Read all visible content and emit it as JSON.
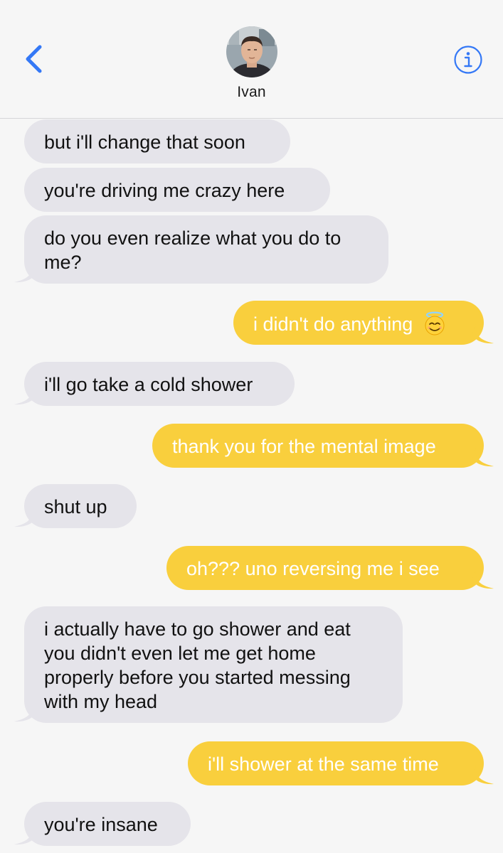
{
  "header": {
    "contact_name": "Ivan",
    "back_icon": "chevron-left-icon",
    "info_icon": "info-icon",
    "accent_color": "#3478f6"
  },
  "colors": {
    "received_bubble": "#e5e4ea",
    "sent_bubble": "#f9cf3d",
    "background": "#f6f6f6"
  },
  "messages": [
    {
      "direction": "received",
      "text": "but i'll change that soon"
    },
    {
      "direction": "received",
      "text": "you're driving me crazy here"
    },
    {
      "direction": "received",
      "lines": [
        "do you even realize what you do to",
        "me?"
      ]
    },
    {
      "direction": "sent",
      "text": "i didn't do anything",
      "emoji": "smiling-face-with-halo"
    },
    {
      "direction": "received",
      "text": "i'll go take a cold shower"
    },
    {
      "direction": "sent",
      "text": "thank you for the mental image"
    },
    {
      "direction": "received",
      "text": "shut up"
    },
    {
      "direction": "sent",
      "text": "oh??? uno reversing me i see"
    },
    {
      "direction": "received",
      "lines": [
        "i actually have to go shower and eat",
        "you didn't even let me get home",
        "properly before you started messing",
        "with my head"
      ]
    },
    {
      "direction": "sent",
      "text": "i'll shower at the same time"
    },
    {
      "direction": "received",
      "text": "you're insane"
    }
  ]
}
